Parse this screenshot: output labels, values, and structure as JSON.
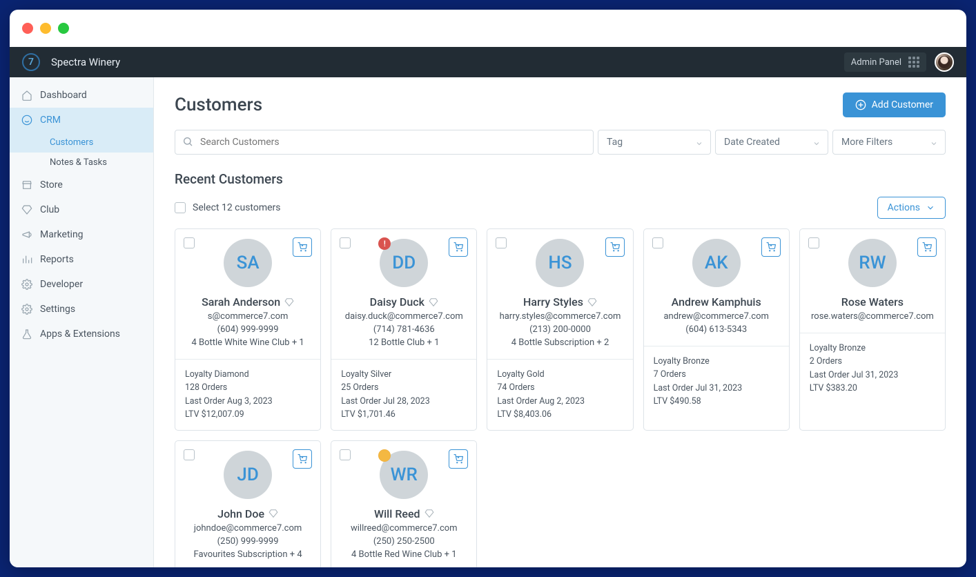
{
  "app": {
    "brand": "Spectra Winery",
    "admin_label": "Admin Panel"
  },
  "sidebar": {
    "items": [
      {
        "label": "Dashboard",
        "icon": "home"
      },
      {
        "label": "CRM",
        "icon": "smile",
        "active": true,
        "children": [
          {
            "label": "Customers",
            "active": true
          },
          {
            "label": "Notes & Tasks"
          }
        ]
      },
      {
        "label": "Store",
        "icon": "store"
      },
      {
        "label": "Club",
        "icon": "diamond"
      },
      {
        "label": "Marketing",
        "icon": "megaphone"
      },
      {
        "label": "Reports",
        "icon": "bars"
      },
      {
        "label": "Developer",
        "icon": "gear"
      },
      {
        "label": "Settings",
        "icon": "gear"
      },
      {
        "label": "Apps & Extensions",
        "icon": "flask"
      }
    ]
  },
  "page": {
    "title": "Customers",
    "add_button": "Add Customer",
    "search_placeholder": "Search Customers",
    "filters": {
      "tag": "Tag",
      "date": "Date Created",
      "more": "More Filters"
    },
    "recent_title": "Recent Customers",
    "select_all": "Select 12 customers",
    "actions_label": "Actions"
  },
  "customers": [
    {
      "initials": "SA",
      "name": "Sarah Anderson",
      "email": "s@commerce7.com",
      "phone": "(604) 999-9999",
      "club": "4 Bottle White Wine Club + 1",
      "loyalty": "Loyalty Diamond",
      "orders": "128 Orders",
      "last": "Last Order Aug 3, 2023",
      "ltv": "LTV $12,007.09",
      "badge": ""
    },
    {
      "initials": "DD",
      "name": "Daisy Duck",
      "email": "daisy.duck@commerce7.com",
      "phone": "(714) 781-4636",
      "club": "12 Bottle Club + 1",
      "loyalty": "Loyalty Silver",
      "orders": "25 Orders",
      "last": "Last Order Jul 28, 2023",
      "ltv": "LTV $1,701.46",
      "badge": "alert"
    },
    {
      "initials": "HS",
      "name": "Harry Styles",
      "email": "harry.styles@commerce7.com",
      "phone": "(213) 200-0000",
      "club": "4 Bottle Subscription + 2",
      "loyalty": "Loyalty Gold",
      "orders": "74 Orders",
      "last": "Last Order Aug 2, 2023",
      "ltv": "LTV $8,403.06",
      "badge": ""
    },
    {
      "initials": "AK",
      "name": "Andrew Kamphuis",
      "email": "andrew@commerce7.com",
      "phone": "(604) 613-5343",
      "club": "",
      "loyalty": "Loyalty Bronze",
      "orders": "7 Orders",
      "last": "Last Order Jul 31, 2023",
      "ltv": "LTV $490.58",
      "badge": "",
      "nodiamond": true
    },
    {
      "initials": "RW",
      "name": "Rose Waters",
      "email": "rose.waters@commerce7.com",
      "phone": "",
      "club": "",
      "loyalty": "Loyalty Bronze",
      "orders": "2 Orders",
      "last": "Last Order Jul 31, 2023",
      "ltv": "LTV $383.20",
      "badge": "",
      "nodiamond": true
    },
    {
      "initials": "JD",
      "name": "John Doe",
      "email": "johndoe@commerce7.com",
      "phone": "(250) 999-9999",
      "club": "Favourites Subscription + 4",
      "loyalty": "",
      "orders": "",
      "last": "",
      "ltv": "",
      "badge": ""
    },
    {
      "initials": "WR",
      "name": "Will Reed",
      "email": "willreed@commerce7.com",
      "phone": "(250) 250-2500",
      "club": "4 Bottle Red Wine Club + 1",
      "loyalty": "",
      "orders": "",
      "last": "",
      "ltv": "",
      "badge": "pizza"
    }
  ]
}
